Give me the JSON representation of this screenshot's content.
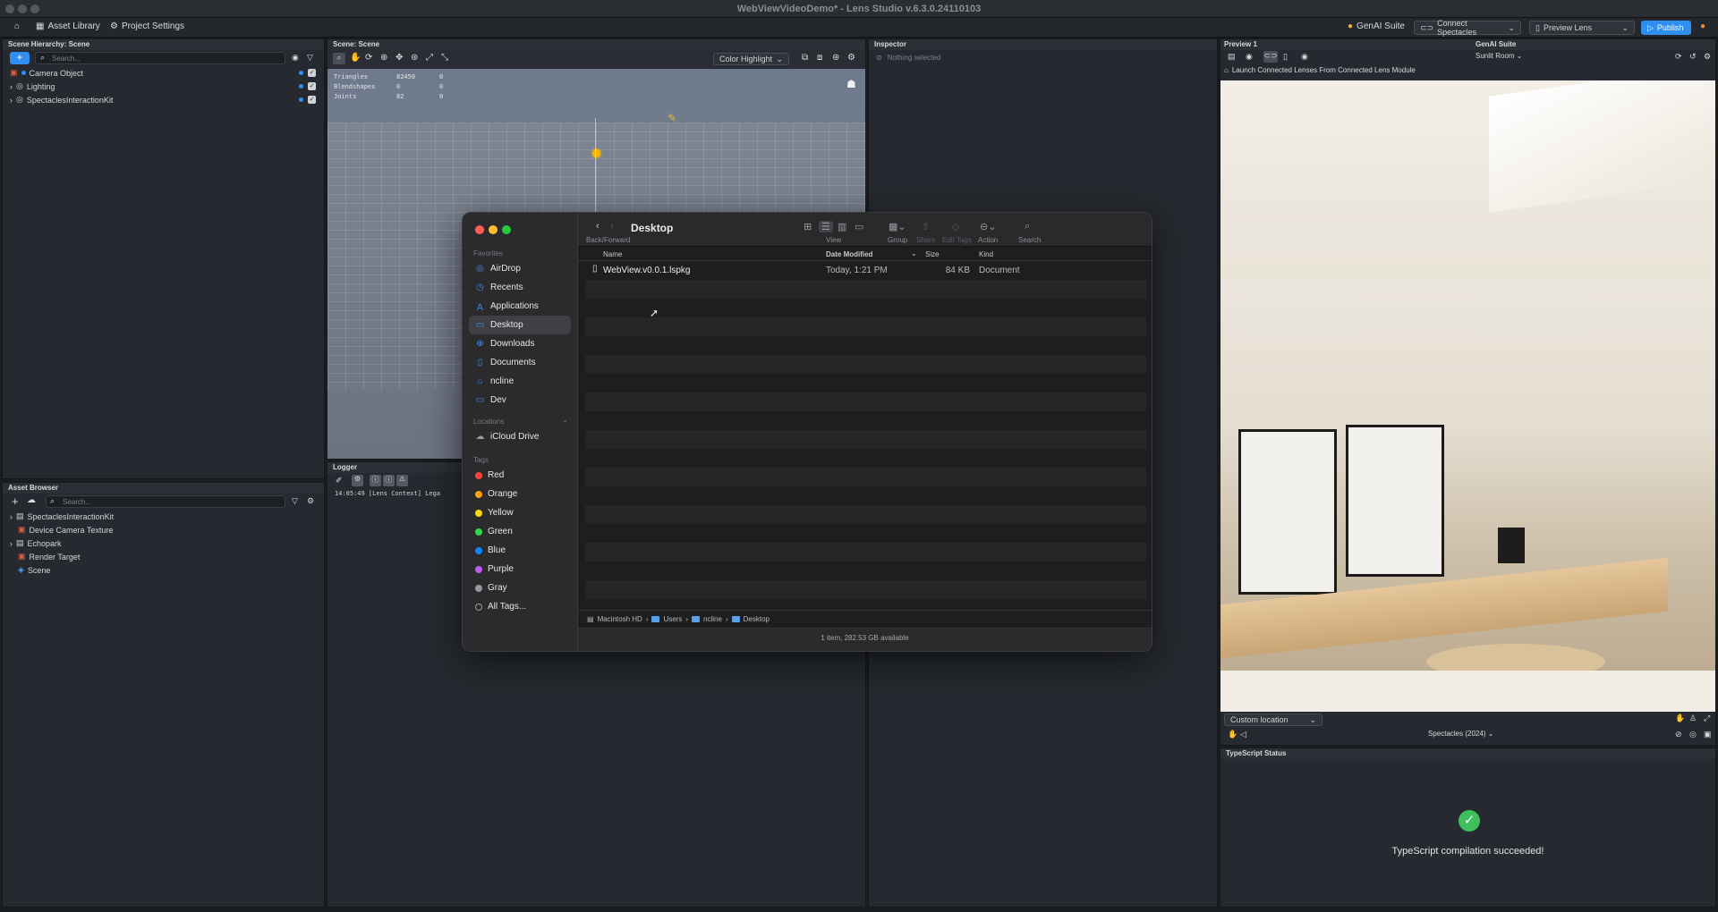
{
  "window": {
    "title": "WebViewVideoDemo* - Lens Studio v.6.3.0.24110103"
  },
  "toolbar": {
    "asset_library": "Asset Library",
    "project_settings": "Project Settings",
    "genai": "GenAI Suite",
    "connect": "Connect Spectacles",
    "preview_lens": "Preview Lens",
    "publish": "Publish"
  },
  "scene_hierarchy": {
    "title": "Scene Hierarchy: Scene",
    "search_placeholder": "Search...",
    "items": [
      "Camera Object",
      "Lighting",
      "SpectaclesInteractionKit"
    ]
  },
  "scene_view": {
    "title": "Scene: Scene",
    "color_mode": "Color Highlight",
    "stats": [
      {
        "label": "Triangles",
        "value": "82450",
        "extra": "0"
      },
      {
        "label": "Blendshapes",
        "value": "0",
        "extra": "0"
      },
      {
        "label": "Joints",
        "value": "82",
        "extra": "0"
      }
    ]
  },
  "inspector": {
    "title": "Inspector",
    "empty": "Nothing selected"
  },
  "preview": {
    "title": "Preview 1",
    "genai_tab": "GenAI Suite",
    "environment": "Sunlit Room",
    "notice": "Launch Connected Lenses From Connected Lens Module",
    "location": "Custom location",
    "device": "Spectacles (2024)"
  },
  "asset_browser": {
    "title": "Asset Browser",
    "search_placeholder": "Search...",
    "items": [
      "SpectaclesInteractionKit",
      "Device Camera Texture",
      "Echopark",
      "Render Target",
      "Scene"
    ]
  },
  "logger": {
    "title": "Logger",
    "line": "14:05:49  [Lens Context] Lega"
  },
  "typescript": {
    "title": "TypeScript Status",
    "message": "TypeScript compilation succeeded!"
  },
  "finder": {
    "title": "Desktop",
    "back_forward": "Back/Forward",
    "view": "View",
    "group": "Group",
    "share": "Share",
    "edit_tags": "Edit Tags",
    "action": "Action",
    "search": "Search",
    "favorites_header": "Favorites",
    "favorites": [
      "AirDrop",
      "Recents",
      "Applications",
      "Desktop",
      "Downloads",
      "Documents",
      "ncline",
      "Dev"
    ],
    "locations_header": "Locations",
    "locations": [
      "iCloud Drive"
    ],
    "tags_header": "Tags",
    "tags": [
      {
        "name": "Red",
        "color": "#ff453a"
      },
      {
        "name": "Orange",
        "color": "#ff9f0a"
      },
      {
        "name": "Yellow",
        "color": "#ffd60a"
      },
      {
        "name": "Green",
        "color": "#32d74b"
      },
      {
        "name": "Blue",
        "color": "#0a84ff"
      },
      {
        "name": "Purple",
        "color": "#bf5af2"
      },
      {
        "name": "Gray",
        "color": "#98989d"
      },
      {
        "name": "All Tags...",
        "color": ""
      }
    ],
    "columns": {
      "name": "Name",
      "date": "Date Modified",
      "size": "Size",
      "kind": "Kind"
    },
    "files": [
      {
        "name": "WebView.v0.0.1.lspkg",
        "date": "Today, 1:21 PM",
        "size": "84 KB",
        "kind": "Document"
      }
    ],
    "path": [
      "Macintosh HD",
      "Users",
      "ncline",
      "Desktop"
    ],
    "status": "1 item, 282.53 GB available"
  }
}
